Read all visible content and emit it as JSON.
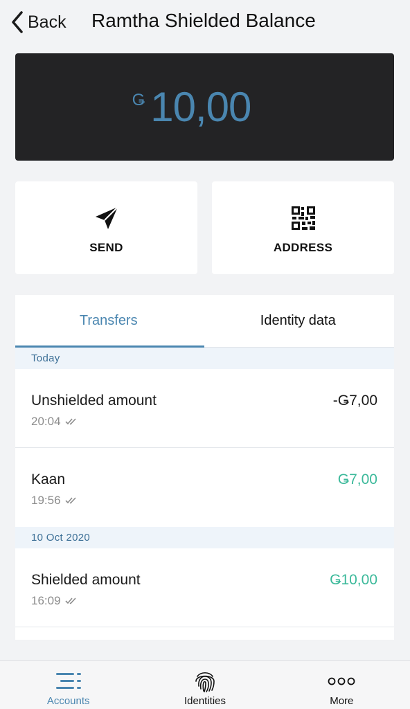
{
  "header": {
    "back_label": "Back",
    "title": "Ramtha Shielded Balance"
  },
  "balance": {
    "currency_symbol": "Ǥ",
    "amount": "10,00"
  },
  "actions": [
    {
      "label": "SEND",
      "icon": "paper-plane-icon"
    },
    {
      "label": "ADDRESS",
      "icon": "qr-code-icon"
    }
  ],
  "tabs": {
    "transfers": "Transfers",
    "identity": "Identity data",
    "active": "Transfers"
  },
  "groups": [
    {
      "date": "Today",
      "transactions": [
        {
          "title": "Unshielded amount",
          "time": "20:04",
          "amount": "-Ǥ7,00",
          "kind": "negative"
        },
        {
          "title": "Kaan",
          "time": "19:56",
          "amount": "Ǥ7,00",
          "kind": "positive"
        }
      ]
    },
    {
      "date": "10 Oct 2020",
      "transactions": [
        {
          "title": "Shielded amount",
          "time": "16:09",
          "amount": "Ǥ10,00",
          "kind": "positive"
        }
      ]
    }
  ],
  "nav": {
    "accounts": "Accounts",
    "identities": "Identities",
    "more": "More",
    "active": "Accounts"
  },
  "colors": {
    "accent": "#4a86b0",
    "positive": "#3bb99a",
    "card_dark": "#232325",
    "date_header_bg": "#eef4fa"
  }
}
